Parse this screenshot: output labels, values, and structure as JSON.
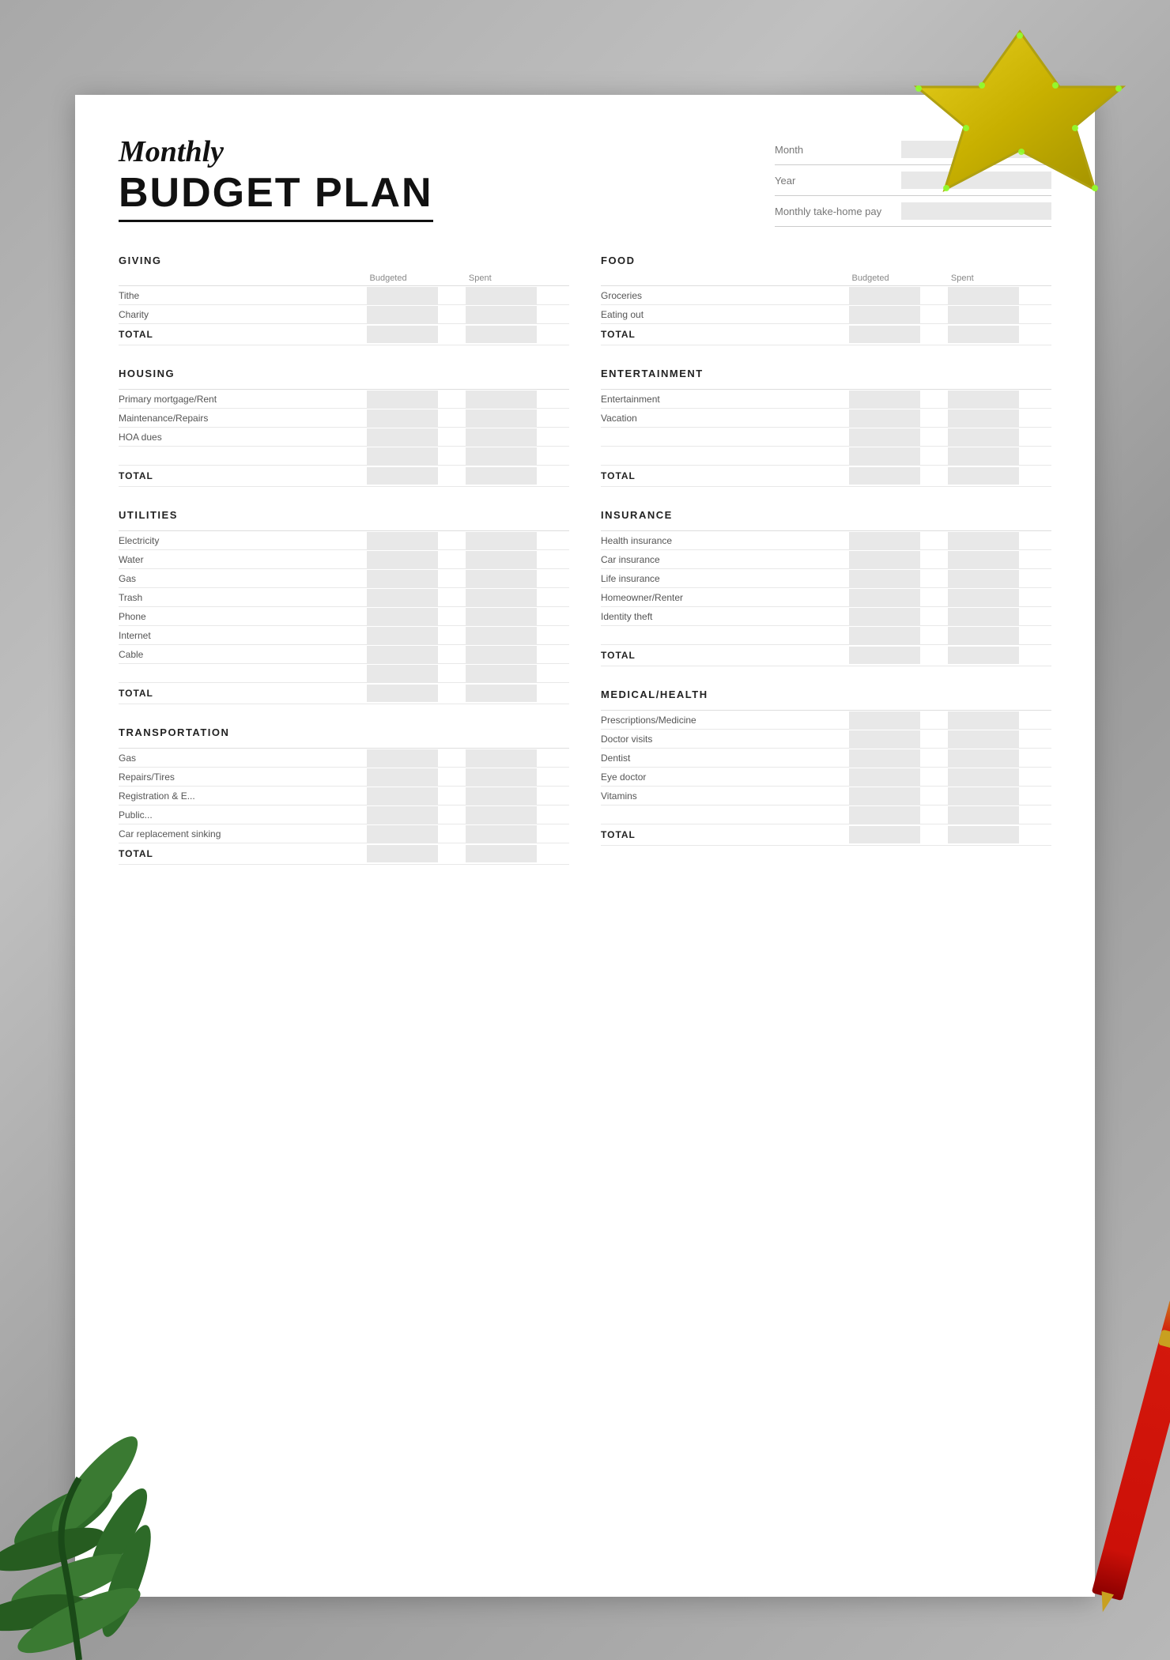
{
  "title": {
    "monthly": "Monthly",
    "budget": "BUDGET PLAN"
  },
  "header_fields": [
    {
      "label": "Month",
      "placeholder": ""
    },
    {
      "label": "Year",
      "placeholder": ""
    },
    {
      "label": "Monthly take-home pay",
      "placeholder": ""
    }
  ],
  "sections": {
    "giving": {
      "title": "GIVING",
      "col_budgeted": "Budgeted",
      "col_spent": "Spent",
      "rows": [
        "Tithe",
        "Charity"
      ],
      "total_label": "TOTAL"
    },
    "food": {
      "title": "FOOD",
      "col_budgeted": "Budgeted",
      "col_spent": "Spent",
      "rows": [
        "Groceries",
        "Eating out"
      ],
      "total_label": "TOTAL"
    },
    "housing": {
      "title": "HOUSING",
      "rows": [
        "Primary mortgage/Rent",
        "Maintenance/Repairs",
        "HOA dues",
        ""
      ],
      "total_label": "TOTAL"
    },
    "entertainment": {
      "title": "ENTERTAINMENT",
      "rows": [
        "Entertainment",
        "Vacation",
        "",
        ""
      ],
      "total_label": "TOTAL"
    },
    "utilities": {
      "title": "UTILITIES",
      "rows": [
        "Electricity",
        "Water",
        "Gas",
        "Trash",
        "Phone",
        "Internet",
        "Cable",
        ""
      ],
      "total_label": "TOTAL"
    },
    "insurance": {
      "title": "INSURANCE",
      "rows": [
        "Health insurance",
        "Car insurance",
        "Life insurance",
        "Homeowner/Renter",
        "Identity theft",
        ""
      ],
      "total_label": "TOTAL"
    },
    "transportation": {
      "title": "TRANSPORTATION",
      "rows": [
        "Gas",
        "Repairs/Tires",
        "Registration & E...",
        "Public...",
        "Car replacement sinking"
      ],
      "total_label": "TOTAL"
    },
    "medical": {
      "title": "MEDICAL/HEALTH",
      "rows": [
        "Prescriptions/Medicine",
        "Doctor visits",
        "Dentist",
        "Eye doctor",
        "Vitamins",
        ""
      ],
      "total_label": "TOTAL"
    }
  }
}
